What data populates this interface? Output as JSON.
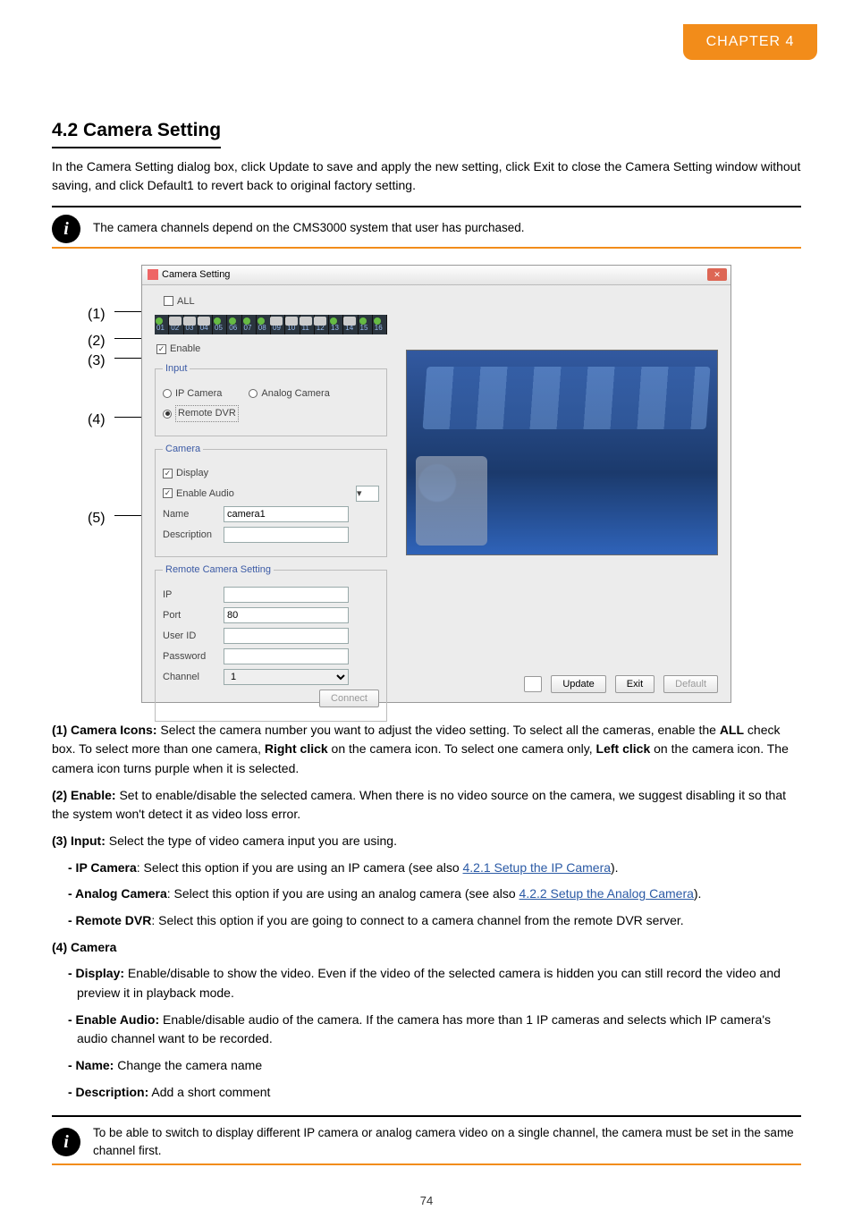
{
  "chapter_tab": "CHAPTER 4",
  "section": {
    "number": "4.2",
    "title": "Camera Setting",
    "subtitle": "In the Camera Setting dialog box, click Update to save and apply the new setting, click Exit to close the Camera Setting window without saving, and click Default1 to revert back to original factory setting."
  },
  "info1": "The camera channels depend on the CMS3000 system that user has purchased.",
  "diagram": {
    "window_title": "Camera Setting",
    "all_label": "ALL",
    "channel_labels": [
      "01",
      "02",
      "03",
      "04",
      "05",
      "06",
      "07",
      "08",
      "09",
      "10",
      "11",
      "12",
      "13",
      "14",
      "15",
      "16"
    ],
    "channel_cam": [
      false,
      true,
      true,
      true,
      false,
      false,
      false,
      false,
      true,
      true,
      true,
      true,
      false,
      true,
      false,
      false
    ],
    "enable_label": "Enable",
    "group_input": {
      "legend": "Input",
      "ip_camera": "IP Camera",
      "analog_camera": "Analog Camera",
      "remote_dvr": "Remote DVR",
      "selected": "remote_dvr"
    },
    "group_camera": {
      "legend": "Camera",
      "display": "Display",
      "enable_audio": "Enable Audio",
      "name_label": "Name",
      "name_value": "camera1",
      "desc_label": "Description",
      "desc_value": ""
    },
    "group_remote": {
      "legend": "Remote Camera Setting",
      "ip_label": "IP",
      "ip_value": "",
      "port_label": "Port",
      "port_value": "80",
      "user_label": "User ID",
      "user_value": "",
      "pwd_label": "Password",
      "pwd_value": "",
      "chan_label": "Channel",
      "chan_value": "1",
      "connect": "Connect"
    },
    "buttons": {
      "update": "Update",
      "exit": "Exit",
      "default": "Default"
    }
  },
  "callouts": [
    "(1)",
    "(2)",
    "(3)",
    "(4)",
    "(5)"
  ],
  "items": {
    "i1a": "(1) Camera Icons:",
    "i1b": " Select the camera number you want to adjust the video setting. To select all the cameras, enable the ",
    "i1c": "ALL",
    "i1d": " check box. To select more than one camera, ",
    "i1e": "Right click",
    "i1f": " on the camera icon. To select one camera only, ",
    "i1g": "Left click",
    "i1h": " on the camera icon. The camera icon turns purple when it is selected.",
    "i2a": "(2) Enable:",
    "i2b": " Set to enable/disable the selected camera. When there is no video source on the camera, we suggest disabling it so that the system won't detect it as video loss error.",
    "i3a": "(3) Input:",
    "i3b": " Select the type of video camera input you are using.",
    "i3_ip_a": "- IP Camera",
    "i3_ip_b": ": Select this option if you are using an IP camera (see also",
    "i3_ip_link": "4.2.1 Setup the IP Camera",
    "i3_ip_c": ").",
    "i3_an_a": "- Analog Camera",
    "i3_an_b": ": Select this option if you are using an analog camera (see also ",
    "i3_an_link": "4.2.2 Setup the Analog Camera",
    "i3_an_c": ").",
    "i3_rd_a": "- Remote DVR",
    "i3_rd_b": ": Select this option if you are going to connect to a camera channel from the remote DVR server.",
    "i4a": "(4) Camera",
    "i4_disp_a": "- Display:",
    "i4_disp_b": " Enable/disable to show the video. Even if the video of the selected camera is hidden you can still record the video and preview it in playback mode.",
    "i4_ea_a": "- Enable Audio:",
    "i4_ea_b": " Enable/disable audio of the camera. If the camera has more than 1 IP cameras and selects which IP camera's audio channel want to be recorded.",
    "i4_name_a": "- Name:",
    "i4_name_b": " Change the camera name",
    "i4_desc_a": "- Description:",
    "i4_desc_b": " Add a short comment"
  },
  "info2": "To be able to switch to display different IP camera or analog camera video on a single channel, the camera must be set in the same channel first.",
  "page_number": "74"
}
